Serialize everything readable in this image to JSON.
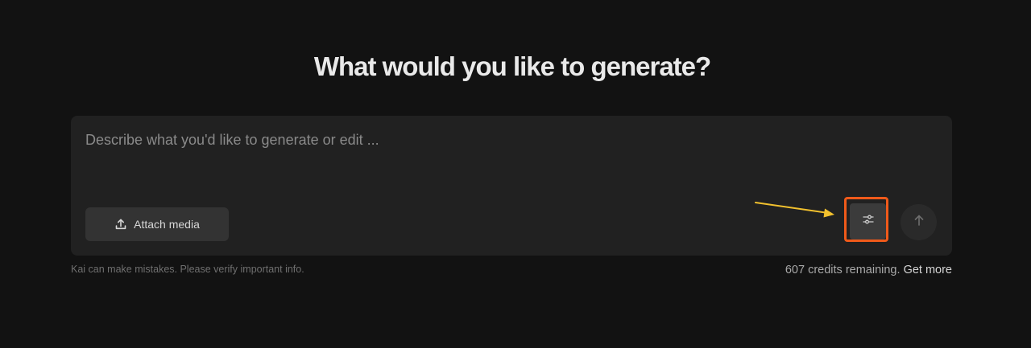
{
  "heading": "What would you like to generate?",
  "composer": {
    "placeholder": "Describe what you'd like to generate or edit ...",
    "value": "",
    "attach_label": "Attach media",
    "attach_icon": "upload-icon",
    "settings_icon": "sliders-icon",
    "send_icon": "arrow-up-icon"
  },
  "annotation": {
    "arrow_color": "#f2c12e",
    "highlight_color": "#f05a1a"
  },
  "footer": {
    "disclaimer": "Kai can make mistakes. Please verify important info.",
    "credits_text": "607 credits remaining.",
    "get_more_label": "Get more"
  }
}
